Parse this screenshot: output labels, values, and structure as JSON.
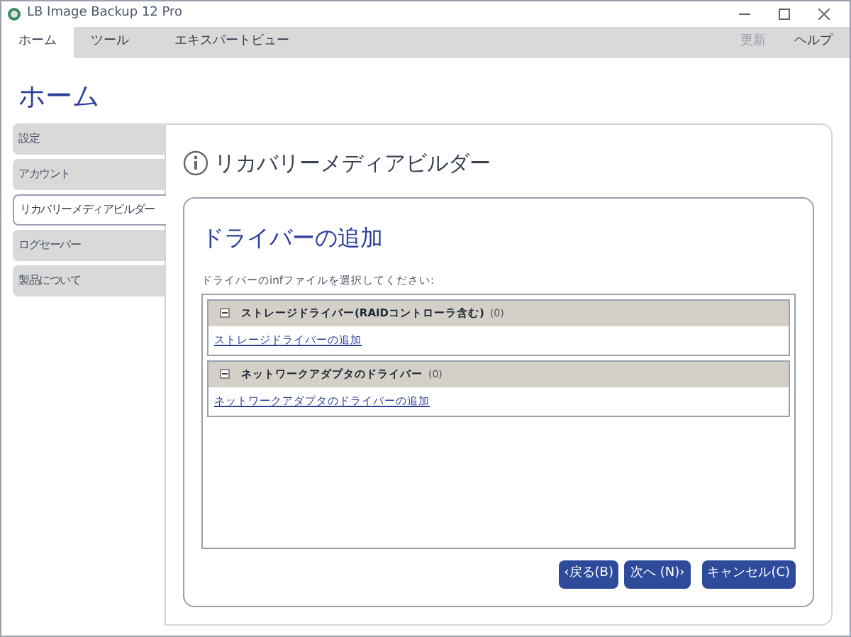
{
  "window": {
    "title": "LB Image Backup 12 Pro"
  },
  "tabs": [
    {
      "label": "ホーム",
      "selected": true
    },
    {
      "label": "ツール",
      "selected": false
    },
    {
      "label": "エキスパートビュー",
      "selected": false
    }
  ],
  "toolbar_right": [
    {
      "label": "更新",
      "disabled": true
    },
    {
      "label": "ヘルプ",
      "disabled": false
    }
  ],
  "page_title": "ホーム",
  "sidebar": {
    "items": [
      {
        "label": "設定",
        "selected": false
      },
      {
        "label": "アカウント",
        "selected": false
      },
      {
        "label": "リカバリーメディアビルダー",
        "selected": true
      },
      {
        "label": "ログセーバー",
        "selected": false
      },
      {
        "label": "製品について",
        "selected": false
      }
    ]
  },
  "panel": {
    "title": "リカバリーメディアビルダー",
    "heading": "ドライバーの追加",
    "instruction": "ドライバーのinfファイルを選択してください:",
    "groups": [
      {
        "title": "ストレージドライバー(RAIDコントローラ含む)",
        "count": "(0)",
        "expanded": true,
        "link": "ストレージドライバーの追加"
      },
      {
        "title": "ネットワークアダプタのドライバー",
        "count": "(0)",
        "expanded": true,
        "link": "ネットワークアダプタのドライバーの追加"
      }
    ],
    "buttons": [
      "‹戻る(B)",
      "次へ (N)›",
      "キャンセル(C)"
    ]
  }
}
